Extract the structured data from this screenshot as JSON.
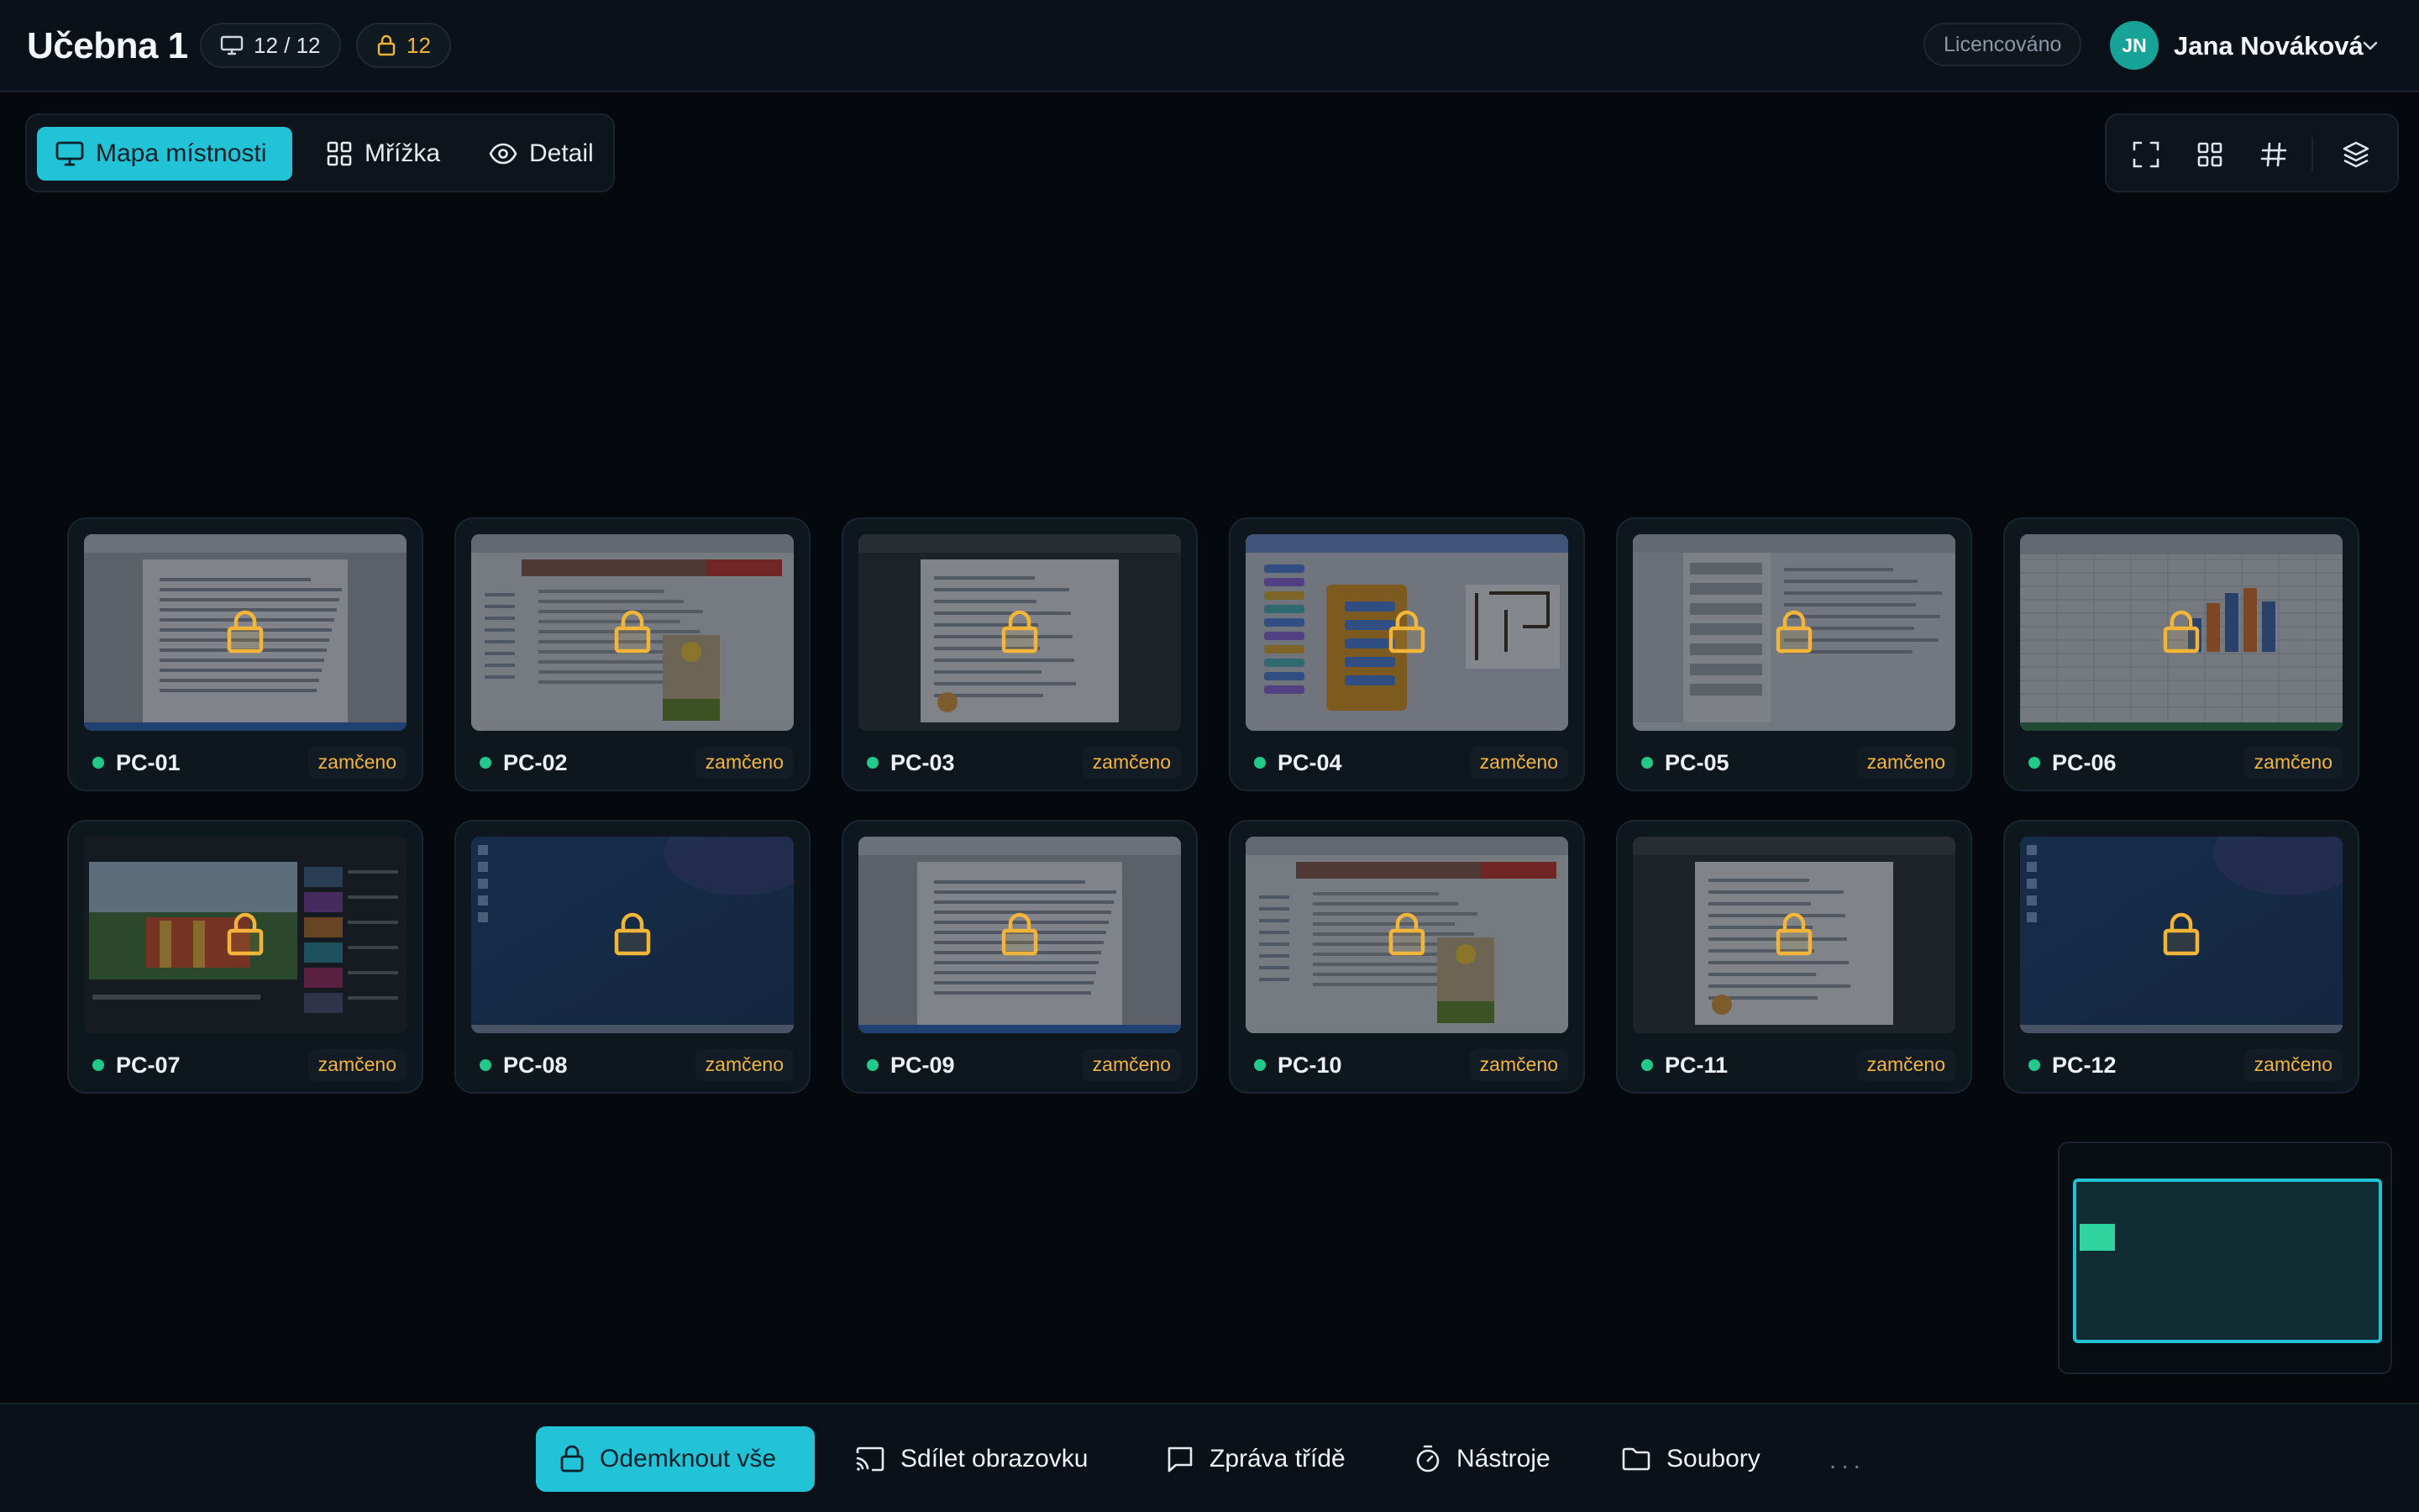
{
  "header": {
    "title": "Učebna 1",
    "screens_count": "12 / 12",
    "locked_count": "12",
    "license_label": "Licencováno",
    "user_initials": "JN",
    "user_name": "Jana Nováková"
  },
  "view_modes": [
    {
      "label": "Mapa místnosti",
      "icon": "monitor-icon",
      "active": true
    },
    {
      "label": "Mřížka",
      "icon": "grid-icon",
      "active": false
    },
    {
      "label": "Detail",
      "icon": "eye-icon",
      "active": false
    }
  ],
  "toolbar_icons": [
    "fullscreen-icon",
    "grid-layout-icon",
    "hash-icon",
    "layers-icon"
  ],
  "computers": [
    {
      "name": "PC-01",
      "status": "zamčeno",
      "content": "document"
    },
    {
      "name": "PC-02",
      "status": "zamčeno",
      "content": "wiki"
    },
    {
      "name": "PC-03",
      "status": "zamčeno",
      "content": "worksheet"
    },
    {
      "name": "PC-04",
      "status": "zamčeno",
      "content": "blocks"
    },
    {
      "name": "PC-05",
      "status": "zamčeno",
      "content": "mail"
    },
    {
      "name": "PC-06",
      "status": "zamčeno",
      "content": "spreadsheet"
    },
    {
      "name": "PC-07",
      "status": "zamčeno",
      "content": "video"
    },
    {
      "name": "PC-08",
      "status": "zamčeno",
      "content": "desktop"
    },
    {
      "name": "PC-09",
      "status": "zamčeno",
      "content": "document"
    },
    {
      "name": "PC-10",
      "status": "zamčeno",
      "content": "wiki"
    },
    {
      "name": "PC-11",
      "status": "zamčeno",
      "content": "worksheet"
    },
    {
      "name": "PC-12",
      "status": "zamčeno",
      "content": "desktop"
    }
  ],
  "bottom_actions": [
    {
      "label": "Odemknout vše",
      "icon": "lock-icon",
      "primary": true
    },
    {
      "label": "Sdílet obrazovku",
      "icon": "cast-icon",
      "primary": false
    },
    {
      "label": "Zpráva třídě",
      "icon": "message-icon",
      "primary": false
    },
    {
      "label": "Nástroje",
      "icon": "timer-icon",
      "primary": false
    },
    {
      "label": "Soubory",
      "icon": "folder-icon",
      "primary": false
    }
  ],
  "more_label": "...",
  "colors": {
    "accent": "#22c3d6",
    "lock": "#f2b53a",
    "online": "#22c98a",
    "background": "#05080d"
  }
}
